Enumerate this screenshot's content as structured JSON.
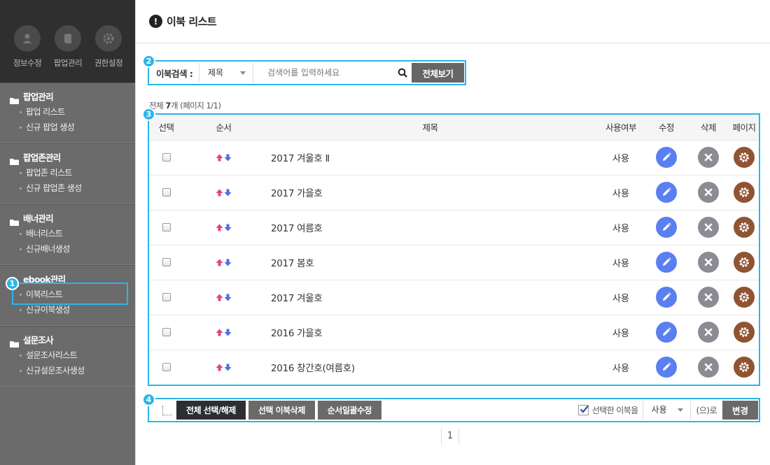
{
  "sidebar": {
    "tools": [
      {
        "label": "정보수정",
        "icon": "user-icon"
      },
      {
        "label": "팝업관리",
        "icon": "book-icon"
      },
      {
        "label": "권한설정",
        "icon": "gear-icon"
      }
    ],
    "groups": [
      {
        "title": "팝업관리",
        "items": [
          "팝업 리스트",
          "신규 팝업 생성"
        ]
      },
      {
        "title": "팝업존관리",
        "items": [
          "팝업존 리스트",
          "신규 팝업존 생성"
        ]
      },
      {
        "title": "배너관리",
        "items": [
          "배너리스트",
          "신규배너생성"
        ]
      },
      {
        "title": "ebook관리",
        "items": [
          "이북리스트",
          "신규이북생성"
        ]
      },
      {
        "title": "설문조사",
        "items": [
          "설문조사리스트",
          "신규설문조사생성"
        ]
      }
    ]
  },
  "header": {
    "title": "이북 리스트"
  },
  "badges": [
    "1",
    "2",
    "3",
    "4"
  ],
  "search": {
    "label": "이북검색 :",
    "field_value": "제목",
    "placeholder": "검색어를 입력하세요",
    "all_button": "전체보기"
  },
  "summary": {
    "prefix": "전체",
    "count": "7",
    "unit": "개",
    "page_info": "(페이지 1/1)"
  },
  "table": {
    "headers": [
      "선택",
      "순서",
      "제목",
      "사용여부",
      "수정",
      "삭제",
      "페이지"
    ],
    "rows": [
      {
        "title": "2017 겨울호 Ⅱ",
        "status": "사용"
      },
      {
        "title": "2017 가을호",
        "status": "사용"
      },
      {
        "title": "2017 여름호",
        "status": "사용"
      },
      {
        "title": "2017 봄호",
        "status": "사용"
      },
      {
        "title": "2017 겨울호",
        "status": "사용"
      },
      {
        "title": "2016 가을호",
        "status": "사용"
      },
      {
        "title": "2016 창간호(여름호)",
        "status": "사용"
      }
    ]
  },
  "bottom": {
    "select_all": "전체 선택/해제",
    "delete_selected": "선택 이북삭제",
    "reorder": "순서일괄수정",
    "selected_text": "선택한 이북을",
    "use_value": "사용",
    "ro_text": "(으)로",
    "change": "변경"
  },
  "pagination": {
    "current": "1"
  },
  "colors": {
    "highlight": "#2ab6ea",
    "sidebar_bg": "#6b6b6b",
    "edit": "#5a7ff0",
    "delete": "#8b8b94",
    "page": "#8f5432",
    "up_arrow": "#e0457b",
    "down_arrow": "#4a6fe0"
  }
}
